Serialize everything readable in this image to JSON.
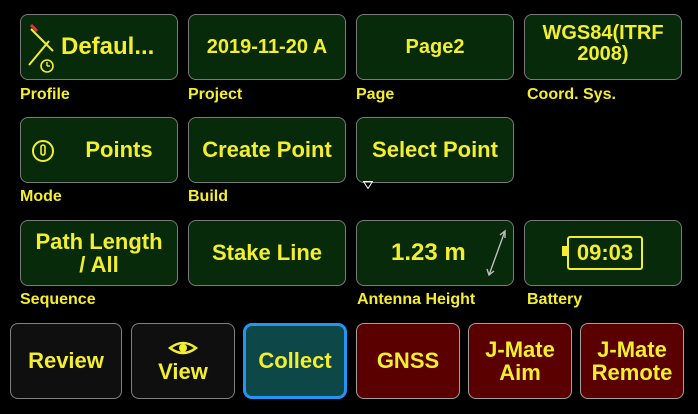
{
  "row1": {
    "profile": {
      "value": "Defaul...",
      "label": "Profile"
    },
    "project": {
      "value": "2019-11-20 A",
      "label": "Project"
    },
    "page": {
      "value": "Page2",
      "label": "Page"
    },
    "coord_sys": {
      "value_line1": "WGS84(ITRF",
      "value_line2": "2008)",
      "label": "Coord. Sys."
    }
  },
  "row2": {
    "mode": {
      "value": "Points",
      "label": "Mode",
      "icon": "mode-icon"
    },
    "build": {
      "value": "Create Point",
      "label": "Build"
    },
    "select_point": {
      "value": "Select Point",
      "icon": "dropdown-triangle-icon"
    }
  },
  "row3": {
    "sequence": {
      "value_line1": "Path Length",
      "value_line2": "/ All",
      "label": "Sequence"
    },
    "stake_line": {
      "value": "Stake Line"
    },
    "antenna": {
      "value": "1.23 m",
      "label": "Antenna Height",
      "icon": "antenna-height-icon"
    },
    "battery": {
      "value": "09:03",
      "label": "Battery",
      "icon": "battery-icon"
    }
  },
  "bottom": {
    "review": "Review",
    "view": "View",
    "collect": "Collect",
    "gnss": "GNSS",
    "jmate_aim_line1": "J-Mate",
    "jmate_aim_line2": "Aim",
    "jmate_remote_line1": "J-Mate",
    "jmate_remote_line2": "Remote"
  },
  "colors": {
    "text": "#f4ef2c",
    "tile_bg": "#062a0a",
    "red_bg": "#5a0000",
    "collect_bg": "#0d4747",
    "collect_border": "#2196f3"
  }
}
